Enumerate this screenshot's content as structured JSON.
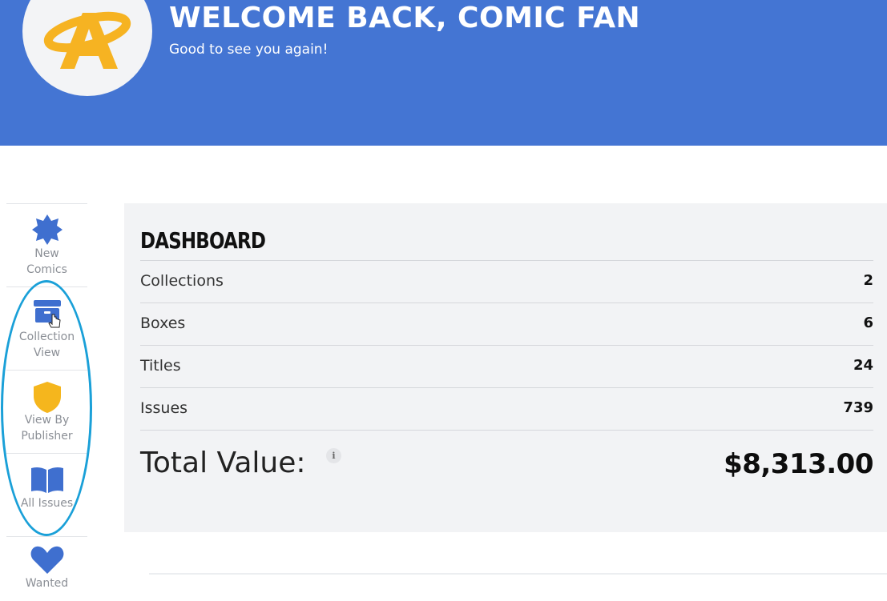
{
  "header": {
    "title": "WELCOME BACK, COMIC FAN",
    "subtitle": "Good to see you again!",
    "logo_icon": "comic-logo-icon",
    "banner_color": "#4475d3",
    "logo_color": "#f6b322"
  },
  "sidebar": {
    "items": [
      {
        "label_line1": "New",
        "label_line2": "Comics",
        "icon": "badge-star-icon",
        "icon_color": "#3f6fcf"
      },
      {
        "label_line1": "Collection",
        "label_line2": "View",
        "icon": "archive-box-icon",
        "icon_color": "#3f6fcf"
      },
      {
        "label_line1": "View By",
        "label_line2": "Publisher",
        "icon": "shield-icon",
        "icon_color": "#f5b61d"
      },
      {
        "label_line1": "All Issues",
        "label_line2": "",
        "icon": "open-book-icon",
        "icon_color": "#3f6fcf"
      },
      {
        "label_line1": "Wanted",
        "label_line2": "",
        "icon": "heart-icon",
        "icon_color": "#3f6fcf"
      }
    ],
    "highlight_color": "#1aa0d8"
  },
  "dashboard": {
    "title": "DASHBOARD",
    "stats": [
      {
        "label": "Collections",
        "value": "2"
      },
      {
        "label": "Boxes",
        "value": "6"
      },
      {
        "label": "Titles",
        "value": "24"
      },
      {
        "label": "Issues",
        "value": "739"
      }
    ],
    "total_label": "Total Value:",
    "info_icon_text": "i",
    "total_value": "$8,313.00"
  }
}
